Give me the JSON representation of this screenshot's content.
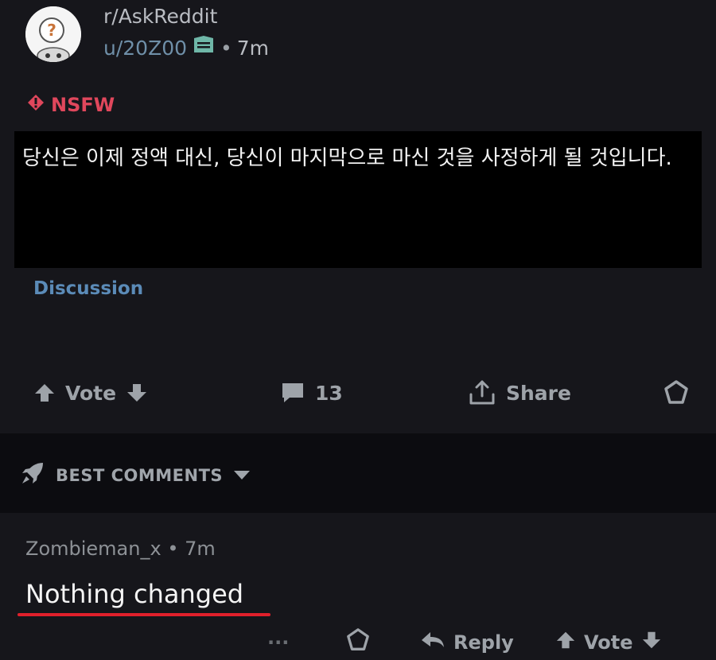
{
  "post": {
    "subreddit": "r/AskReddit",
    "username": "u/20Z00",
    "separator": "•",
    "age": "7m",
    "nsfw_label": "NSFW",
    "body": "당신은 이제 정액 대신, 당신이 마지막으로 마신 것을 사정하게 될 것입니다.",
    "flair": "Discussion"
  },
  "actions": {
    "vote_label": "Vote",
    "comment_count": "13",
    "share_label": "Share"
  },
  "comments_header": {
    "label": "BEST COMMENTS"
  },
  "comment": {
    "author": "Zombieman_x",
    "separator": "•",
    "age": "7m",
    "text": "Nothing changed",
    "more_label": "···",
    "reply_label": "Reply",
    "vote_label": "Vote"
  },
  "colors": {
    "background": "#16161b",
    "nsfw": "#e0475c",
    "flair": "#5b8bb8",
    "underline": "#e0202b"
  },
  "icons": [
    "avatar-icon",
    "badge-icon",
    "nsfw-icon",
    "upvote-icon",
    "downvote-icon",
    "comment-icon",
    "share-icon",
    "award-icon",
    "rocket-icon",
    "chevron-down-icon",
    "reply-icon"
  ]
}
